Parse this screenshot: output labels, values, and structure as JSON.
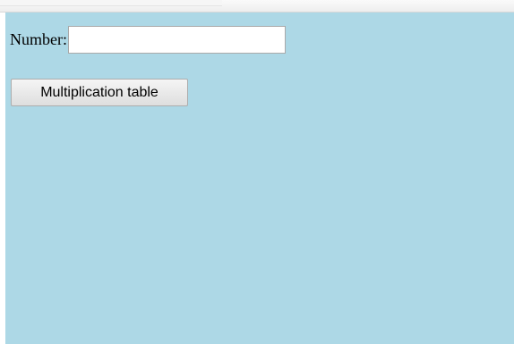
{
  "page": {
    "background_color": "#add8e6"
  },
  "form": {
    "number_label": "Number:",
    "number_value": "",
    "number_placeholder": "",
    "button_label": "Multiplication table"
  }
}
